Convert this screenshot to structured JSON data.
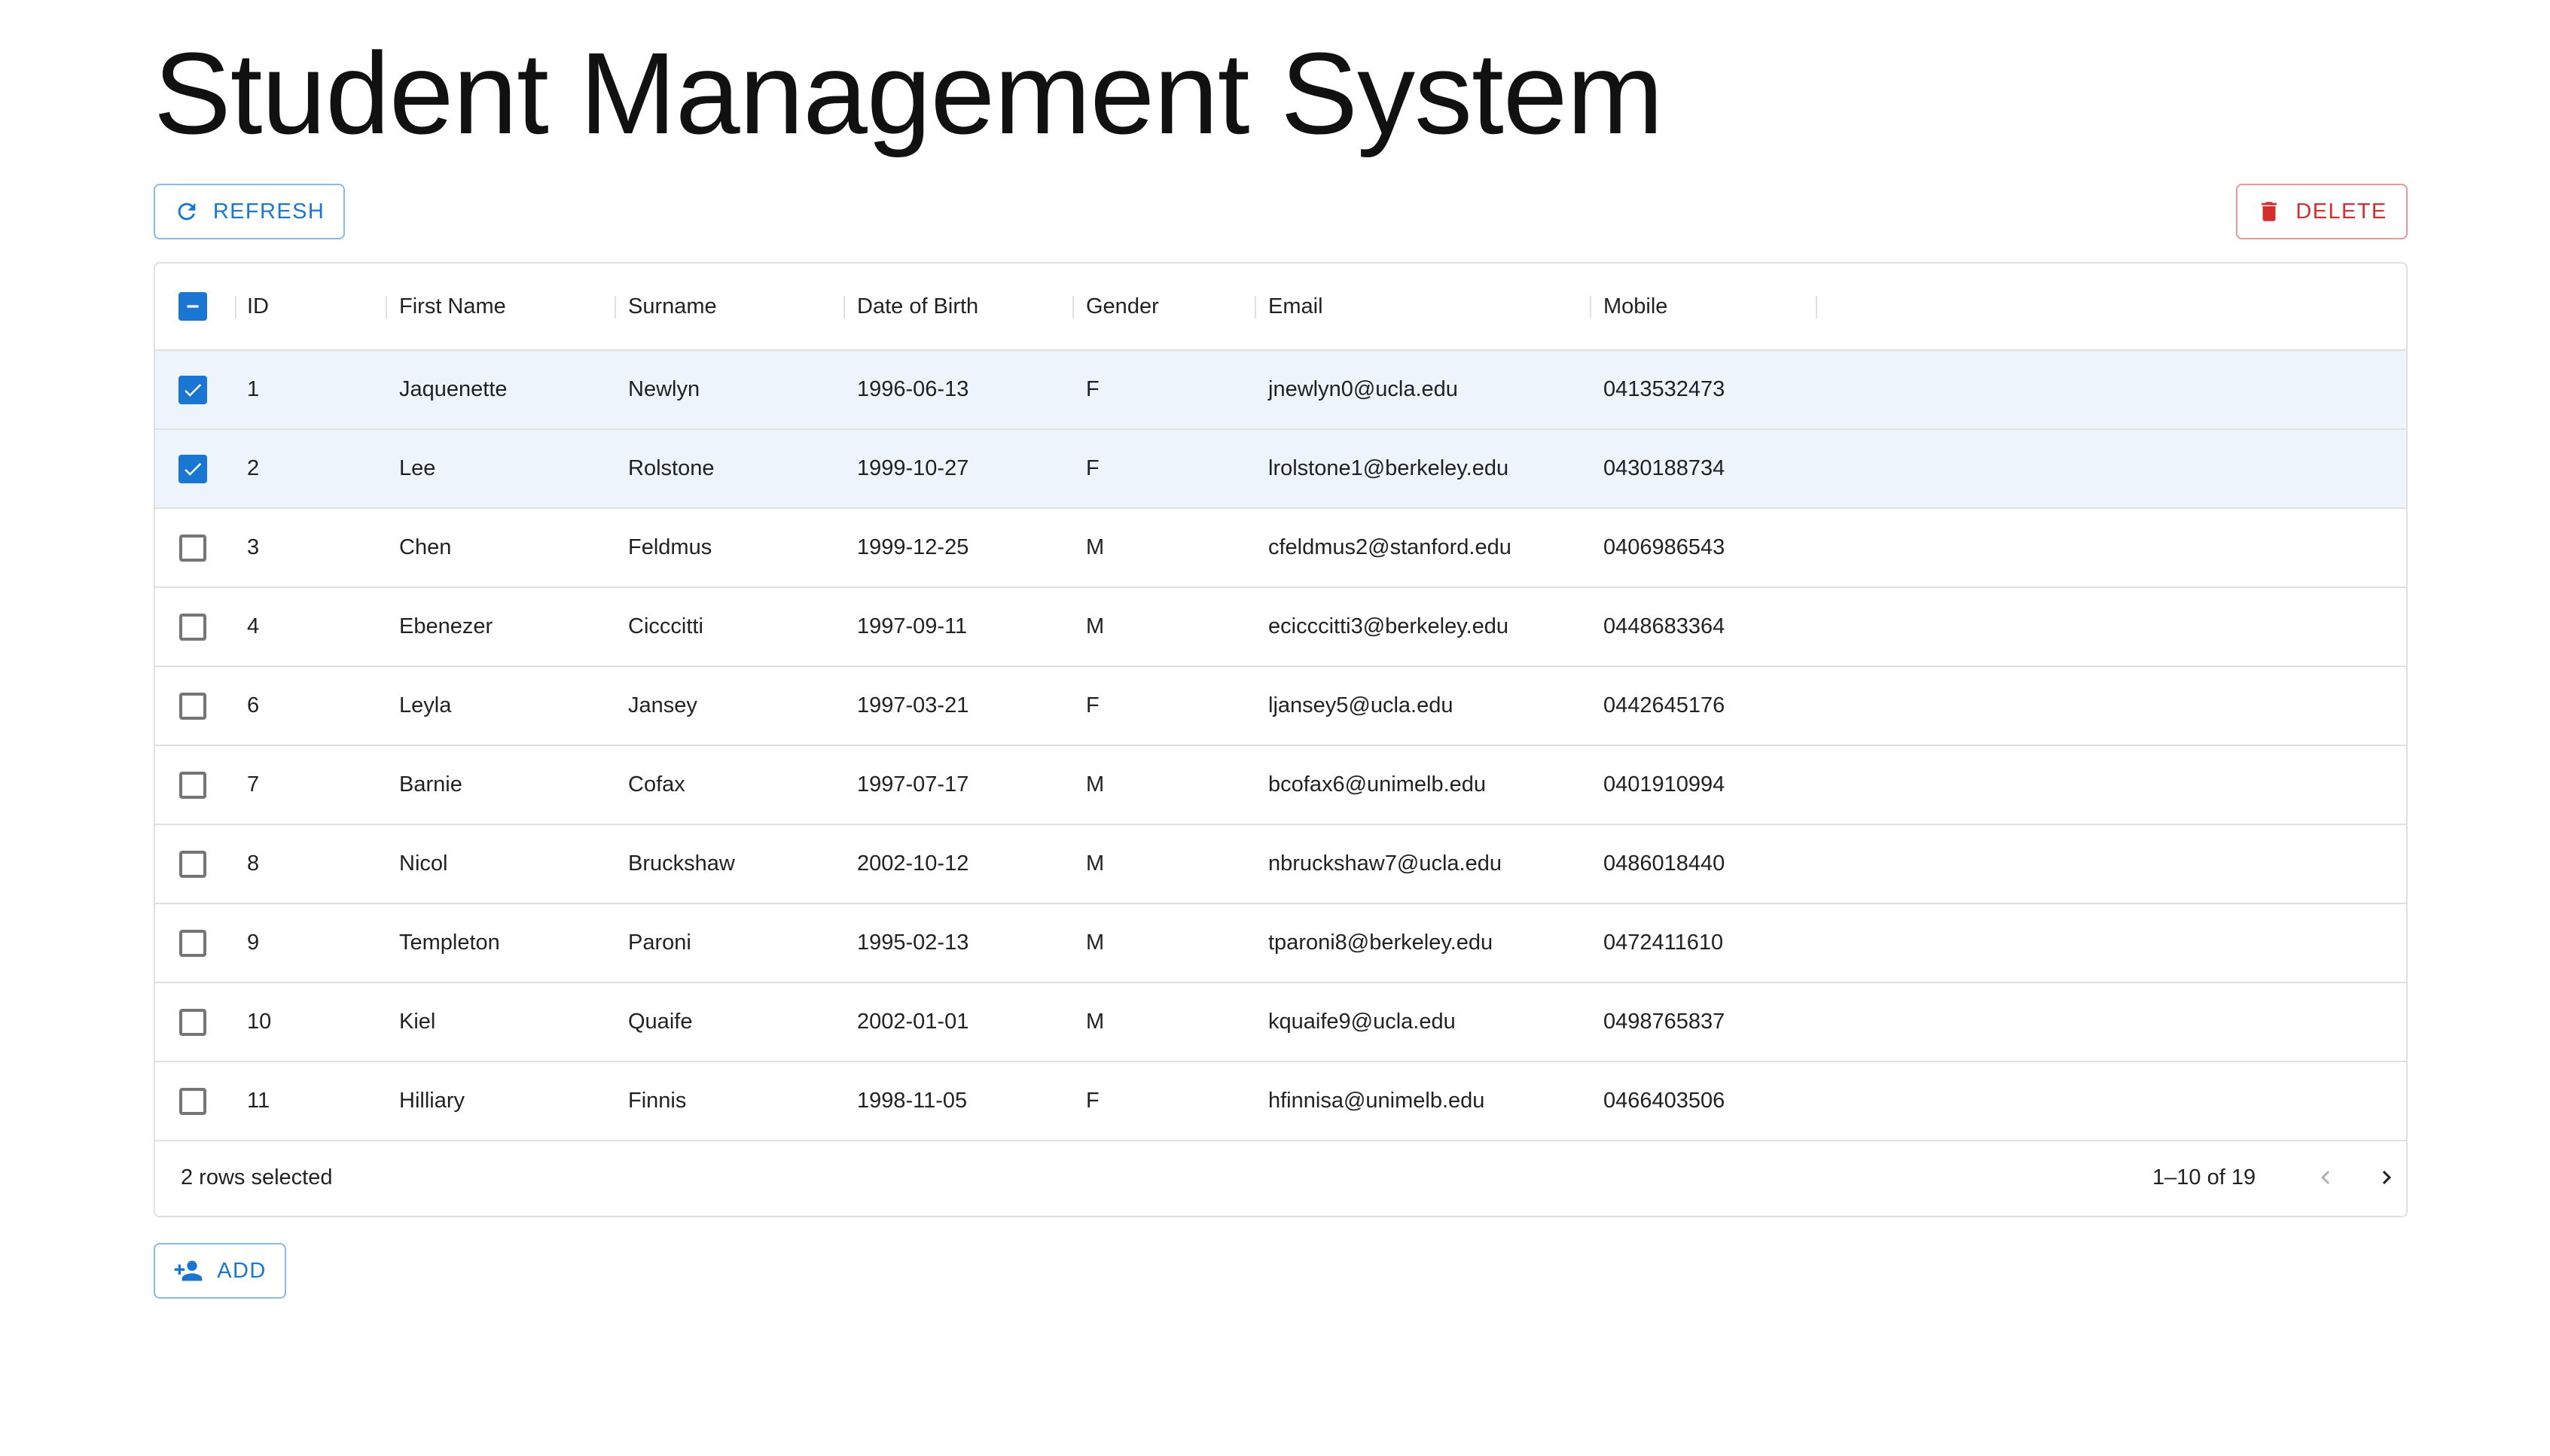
{
  "page": {
    "title": "Student Management System"
  },
  "toolbar": {
    "refresh_label": "REFRESH",
    "delete_label": "DELETE",
    "add_label": "ADD"
  },
  "colors": {
    "primary": "#1976d2",
    "error": "#d32f2f",
    "selected_row": "#e8f0fa",
    "border": "#e0e0e0"
  },
  "icons": {
    "refresh": "refresh-icon",
    "delete": "trash-icon",
    "add": "person-add-icon",
    "prev": "chevron-left-icon",
    "next": "chevron-right-icon"
  },
  "grid": {
    "columns": [
      "ID",
      "First Name",
      "Surname",
      "Date of Birth",
      "Gender",
      "Email",
      "Mobile"
    ],
    "header_checkbox_state": "indeterminate",
    "rows": [
      {
        "selected": true,
        "cells": [
          "1",
          "Jaquenette",
          "Newlyn",
          "1996-06-13",
          "F",
          "jnewlyn0@ucla.edu",
          "0413532473"
        ]
      },
      {
        "selected": true,
        "cells": [
          "2",
          "Lee",
          "Rolstone",
          "1999-10-27",
          "F",
          "lrolstone1@berkeley.edu",
          "0430188734"
        ]
      },
      {
        "selected": false,
        "cells": [
          "3",
          "Chen",
          "Feldmus",
          "1999-12-25",
          "M",
          "cfeldmus2@stanford.edu",
          "0406986543"
        ]
      },
      {
        "selected": false,
        "cells": [
          "4",
          "Ebenezer",
          "Cicccitti",
          "1997-09-11",
          "M",
          "ecicccitti3@berkeley.edu",
          "0448683364"
        ]
      },
      {
        "selected": false,
        "cells": [
          "6",
          "Leyla",
          "Jansey",
          "1997-03-21",
          "F",
          "ljansey5@ucla.edu",
          "0442645176"
        ]
      },
      {
        "selected": false,
        "cells": [
          "7",
          "Barnie",
          "Cofax",
          "1997-07-17",
          "M",
          "bcofax6@unimelb.edu",
          "0401910994"
        ]
      },
      {
        "selected": false,
        "cells": [
          "8",
          "Nicol",
          "Bruckshaw",
          "2002-10-12",
          "M",
          "nbruckshaw7@ucla.edu",
          "0486018440"
        ]
      },
      {
        "selected": false,
        "cells": [
          "9",
          "Templeton",
          "Paroni",
          "1995-02-13",
          "M",
          "tparoni8@berkeley.edu",
          "0472411610"
        ]
      },
      {
        "selected": false,
        "cells": [
          "10",
          "Kiel",
          "Quaife",
          "2002-01-01",
          "M",
          "kquaife9@ucla.edu",
          "0498765837"
        ]
      },
      {
        "selected": false,
        "cells": [
          "11",
          "Hilliary",
          "Finnis",
          "1998-11-05",
          "F",
          "hfinnisa@unimelb.edu",
          "0466403506"
        ]
      }
    ],
    "footer": {
      "selected_text": "2 rows selected",
      "range_text": "1–10 of 19"
    }
  }
}
